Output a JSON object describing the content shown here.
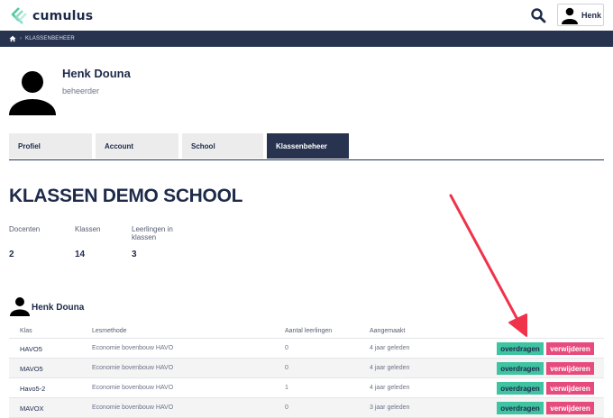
{
  "brand": {
    "name": "cumulus"
  },
  "topbar": {
    "user_label": "Henk"
  },
  "breadcrumb": {
    "items": [
      "KLASSENBEHEER"
    ]
  },
  "profile": {
    "name": "Henk Douna",
    "role": "beheerder"
  },
  "tabs": [
    {
      "label": "Profiel",
      "active": false
    },
    {
      "label": "Account",
      "active": false
    },
    {
      "label": "School",
      "active": false
    },
    {
      "label": "Klassenbeheer",
      "active": true
    }
  ],
  "heading": "KLASSEN DEMO SCHOOL",
  "stats": [
    {
      "label": "Docenten",
      "value": "2"
    },
    {
      "label": "Klassen",
      "value": "14"
    },
    {
      "label": "Leerlingen in klassen",
      "value": "3"
    }
  ],
  "owner": {
    "name": "Henk Douna"
  },
  "table": {
    "columns": [
      "Klas",
      "Lesmethode",
      "Aantal leerlingen",
      "Aangemaakt"
    ],
    "rows": [
      {
        "klas": "HAVO5",
        "lesmethode": "Economie bovenbouw HAVO",
        "aantal": "0",
        "aangemaakt": "4 jaar geleden"
      },
      {
        "klas": "MAVO5",
        "lesmethode": "Economie bovenbouw HAVO",
        "aantal": "0",
        "aangemaakt": "4 jaar geleden"
      },
      {
        "klas": "Havo5-2",
        "lesmethode": "Economie bovenbouw HAVO",
        "aantal": "1",
        "aangemaakt": "4 jaar geleden"
      },
      {
        "klas": "MAVOX",
        "lesmethode": "Economie bovenbouw HAVO",
        "aantal": "0",
        "aangemaakt": "3 jaar geleden"
      }
    ],
    "actions": {
      "transfer_label": "overdragen",
      "delete_label": "verwijderen"
    }
  },
  "colors": {
    "navy": "#27334f",
    "transfer_button": "#3ec4a1",
    "delete_button": "#e64b7d",
    "annotation_arrow": "#f0324a"
  },
  "icons": [
    "cumulus-logo-icon",
    "search-icon",
    "user-avatar-icon",
    "home-icon"
  ]
}
